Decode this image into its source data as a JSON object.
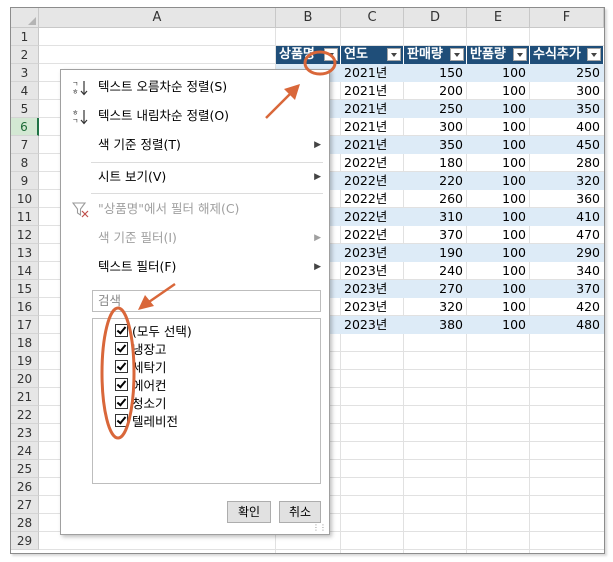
{
  "columns": [
    "A",
    "B",
    "C",
    "D",
    "E",
    "F"
  ],
  "rows": [
    "1",
    "2",
    "3",
    "4",
    "5",
    "6",
    "7",
    "8",
    "9",
    "10",
    "11",
    "12",
    "13",
    "14",
    "15",
    "16",
    "17",
    "18",
    "19",
    "20",
    "21",
    "22",
    "23",
    "24",
    "25",
    "26",
    "27",
    "28",
    "29"
  ],
  "active_row": "6",
  "table": {
    "headers": [
      "상품명",
      "연도",
      "판매량",
      "반품량",
      "수식추가"
    ],
    "rows": [
      {
        "year": "2021년",
        "sales": "150",
        "returns": "100",
        "formula": "250"
      },
      {
        "year": "2021년",
        "sales": "200",
        "returns": "100",
        "formula": "300"
      },
      {
        "year": "2021년",
        "sales": "250",
        "returns": "100",
        "formula": "350"
      },
      {
        "year": "2021년",
        "sales": "300",
        "returns": "100",
        "formula": "400"
      },
      {
        "year": "2021년",
        "sales": "350",
        "returns": "100",
        "formula": "450"
      },
      {
        "year": "2022년",
        "sales": "180",
        "returns": "100",
        "formula": "280"
      },
      {
        "year": "2022년",
        "sales": "220",
        "returns": "100",
        "formula": "320"
      },
      {
        "year": "2022년",
        "sales": "260",
        "returns": "100",
        "formula": "360"
      },
      {
        "year": "2022년",
        "sales": "310",
        "returns": "100",
        "formula": "410"
      },
      {
        "year": "2022년",
        "sales": "370",
        "returns": "100",
        "formula": "470"
      },
      {
        "year": "2023년",
        "sales": "190",
        "returns": "100",
        "formula": "290"
      },
      {
        "year": "2023년",
        "sales": "240",
        "returns": "100",
        "formula": "340"
      },
      {
        "year": "2023년",
        "sales": "270",
        "returns": "100",
        "formula": "370"
      },
      {
        "year": "2023년",
        "sales": "320",
        "returns": "100",
        "formula": "420"
      },
      {
        "year": "2023년",
        "sales": "380",
        "returns": "100",
        "formula": "480"
      }
    ]
  },
  "filter_menu": {
    "sort_asc": "텍스트 오름차순 정렬(S)",
    "sort_desc": "텍스트 내림차순 정렬(O)",
    "sort_by_color": "색 기준 정렬(T)",
    "sheet_view": "시트 보기(V)",
    "clear_filter": "\"상품명\"에서 필터 해제(C)",
    "filter_by_color": "색 기준 필터(I)",
    "text_filter": "텍스트 필터(F)",
    "search_placeholder": "검색",
    "checkbox_items": [
      "(모두 선택)",
      "냉장고",
      "세탁기",
      "에어컨",
      "청소기",
      "텔레비전"
    ],
    "ok_label": "확인",
    "cancel_label": "취소"
  },
  "colors": {
    "table_header": "#1f4e79",
    "band": "#ddebf7",
    "annotation": "#d9673a"
  },
  "icons": [
    "sort-ascending-icon",
    "sort-descending-icon",
    "clear-filter-icon",
    "submenu-arrow-icon",
    "dropdown-arrow-icon"
  ]
}
